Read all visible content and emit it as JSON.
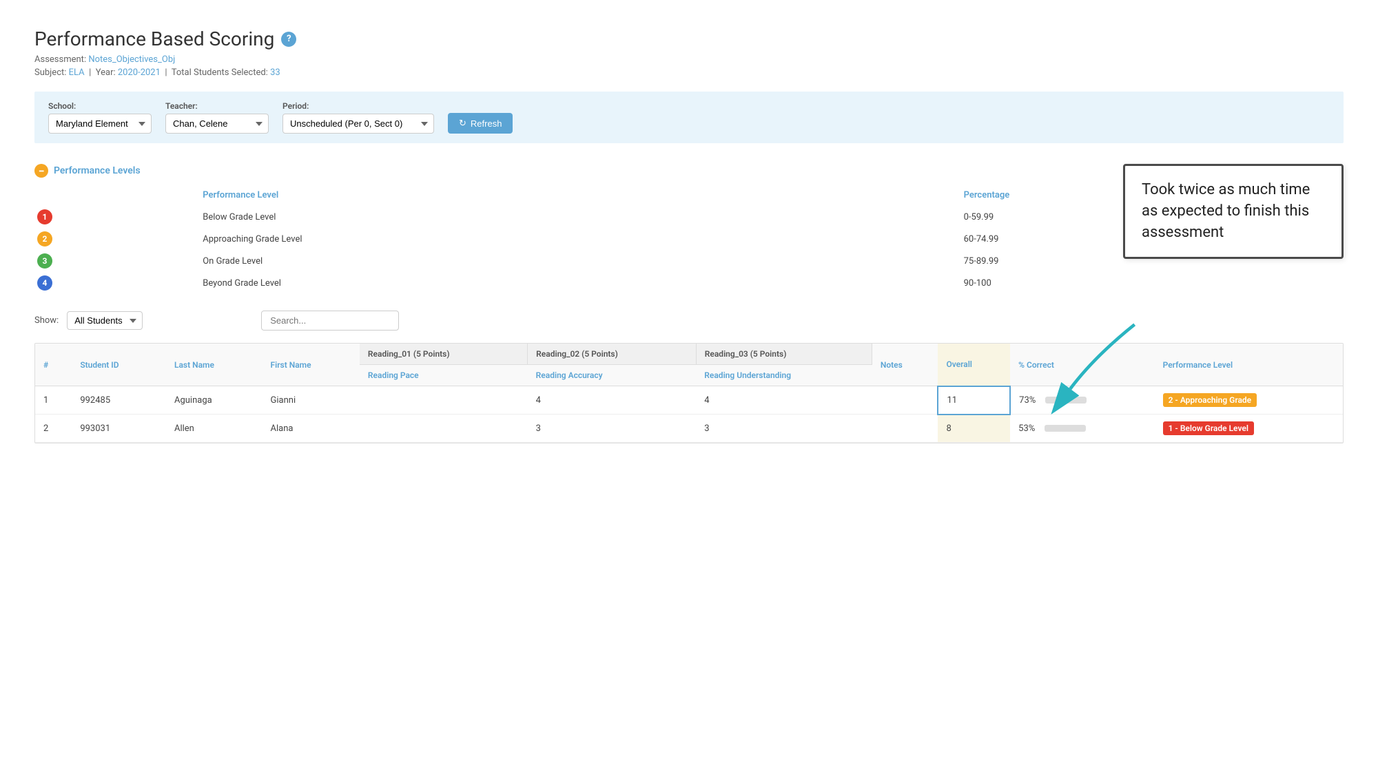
{
  "page": {
    "title": "Performance Based Scoring",
    "help_icon": "?",
    "assessment_label": "Assessment:",
    "assessment_link": "Notes_Objectives_Obj",
    "subject_label": "Subject:",
    "subject_value": "ELA",
    "year_label": "Year:",
    "year_value": "2020-2021",
    "students_label": "Total Students Selected:",
    "students_value": "33"
  },
  "filters": {
    "school_label": "School:",
    "school_value": "Maryland Element",
    "teacher_label": "Teacher:",
    "teacher_value": "Chan, Celene",
    "period_label": "Period:",
    "period_value": "Unscheduled (Per 0, Sect 0)",
    "refresh_label": "Refresh"
  },
  "performance_levels": {
    "section_title": "Performance Levels",
    "col_level": "Performance Level",
    "col_percentage": "Percentage",
    "levels": [
      {
        "badge": "1",
        "label": "Below Grade Level",
        "range": "0-59.99"
      },
      {
        "badge": "2",
        "label": "Approaching Grade Level",
        "range": "60-74.99"
      },
      {
        "badge": "3",
        "label": "On Grade Level",
        "range": "75-89.99"
      },
      {
        "badge": "4",
        "label": "Beyond Grade Level",
        "range": "90-100"
      }
    ]
  },
  "show": {
    "label": "Show:",
    "value": "All Students"
  },
  "search": {
    "placeholder": "Search..."
  },
  "table": {
    "col_hash": "#",
    "col_student_id": "Student ID",
    "col_last_name": "Last Name",
    "col_first_name": "First Name",
    "group1_header": "Reading_01  (5 Points)",
    "group1_sub": "Reading Pace",
    "group2_header": "Reading_02  (5 Points)",
    "group2_sub": "Reading Accuracy",
    "group3_header": "Reading_03  (5 Points)",
    "group3_sub": "Reading Understanding",
    "col_notes": "Notes",
    "col_overall": "Overall",
    "col_percent": "% Correct",
    "col_perf_level": "Performance Level",
    "rows": [
      {
        "num": "1",
        "student_id": "992485",
        "last_name": "Aguinaga",
        "first_name": "Gianni",
        "reading_01": "",
        "reading_02": "4",
        "reading_03": "4",
        "notes": "",
        "overall": "11",
        "percent": "73%",
        "percent_val": 73,
        "perf_level": "2 - Approaching Grade",
        "perf_class": "pl-approaching",
        "overall_highlighted": true
      },
      {
        "num": "2",
        "student_id": "993031",
        "last_name": "Allen",
        "first_name": "Alana",
        "reading_01": "",
        "reading_02": "3",
        "reading_03": "3",
        "notes": "",
        "overall": "8",
        "percent": "53%",
        "percent_val": 53,
        "perf_level": "1 - Below Grade Level",
        "perf_class": "pl-below",
        "overall_highlighted": false
      }
    ]
  },
  "annotation": {
    "text": "Took twice as much time as expected to finish this assessment"
  }
}
